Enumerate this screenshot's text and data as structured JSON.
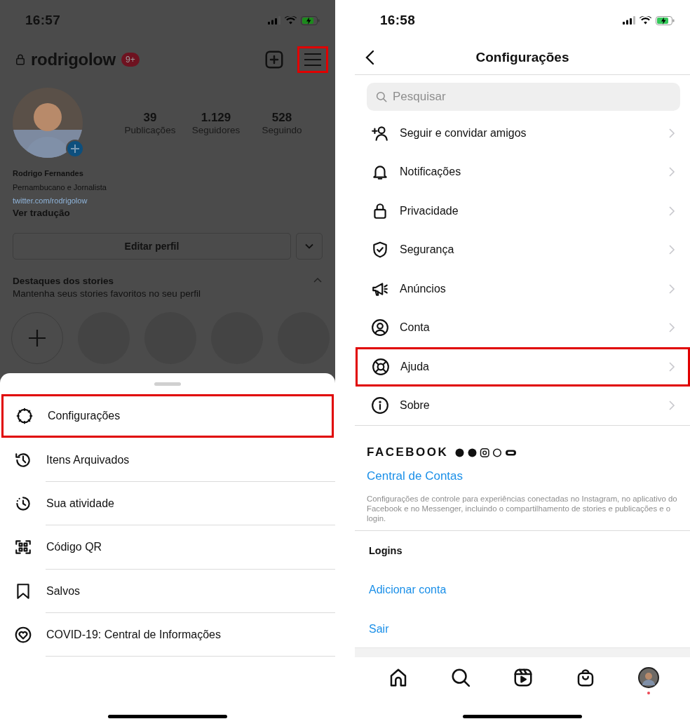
{
  "left": {
    "status_bar": {
      "time": "16:57"
    },
    "header": {
      "username": "rodrigolow",
      "badge": "9+",
      "menu_highlighted": true
    },
    "profile": {
      "stats": [
        {
          "value": "39",
          "label": "Publicações"
        },
        {
          "value": "1.129",
          "label": "Seguidores"
        },
        {
          "value": "528",
          "label": "Seguindo"
        }
      ],
      "name": "Rodrigo Fernandes",
      "bio": "Pernambucano e Jornalista",
      "link": "twitter.com/rodrigolow",
      "translate": "Ver tradução",
      "edit_button": "Editar perfil"
    },
    "highlights": {
      "title": "Destaques dos stories",
      "subtitle": "Mantenha seus stories favoritos no seu perfil",
      "expanded": true
    },
    "sheet": {
      "items": [
        {
          "label": "Configurações",
          "kind": "gear",
          "highlighted": true
        },
        {
          "label": "Itens Arquivados",
          "kind": "history",
          "highlighted": false
        },
        {
          "label": "Sua atividade",
          "kind": "activity",
          "highlighted": false
        },
        {
          "label": "Código QR",
          "kind": "qr",
          "highlighted": false
        },
        {
          "label": "Salvos",
          "kind": "bookmark",
          "highlighted": false
        },
        {
          "label": "COVID-19: Central de Informações",
          "kind": "covid",
          "highlighted": false
        }
      ]
    }
  },
  "right": {
    "status_bar": {
      "time": "16:58"
    },
    "header": {
      "title": "Configurações"
    },
    "search": {
      "placeholder": "Pesquisar"
    },
    "items": [
      {
        "label": "Seguir e convidar amigos",
        "kind": "person-plus",
        "highlighted": false
      },
      {
        "label": "Notificações",
        "kind": "bell",
        "highlighted": false
      },
      {
        "label": "Privacidade",
        "kind": "lock",
        "highlighted": false
      },
      {
        "label": "Segurança",
        "kind": "shield",
        "highlighted": false
      },
      {
        "label": "Anúncios",
        "kind": "megaphone",
        "highlighted": false
      },
      {
        "label": "Conta",
        "kind": "person-circle",
        "highlighted": false
      },
      {
        "label": "Ajuda",
        "kind": "lifebuoy",
        "highlighted": true
      },
      {
        "label": "Sobre",
        "kind": "info",
        "highlighted": false
      }
    ],
    "facebook": {
      "brand": "FACEBOOK",
      "link": "Central de Contas",
      "description": "Configurações de controle para experiências conectadas no Instagram, no aplicativo do Facebook e no Messenger, incluindo o compartilhamento de stories e publicações e o login."
    },
    "logins": {
      "title": "Logins",
      "actions": [
        "Adicionar conta",
        "Sair"
      ]
    }
  }
}
